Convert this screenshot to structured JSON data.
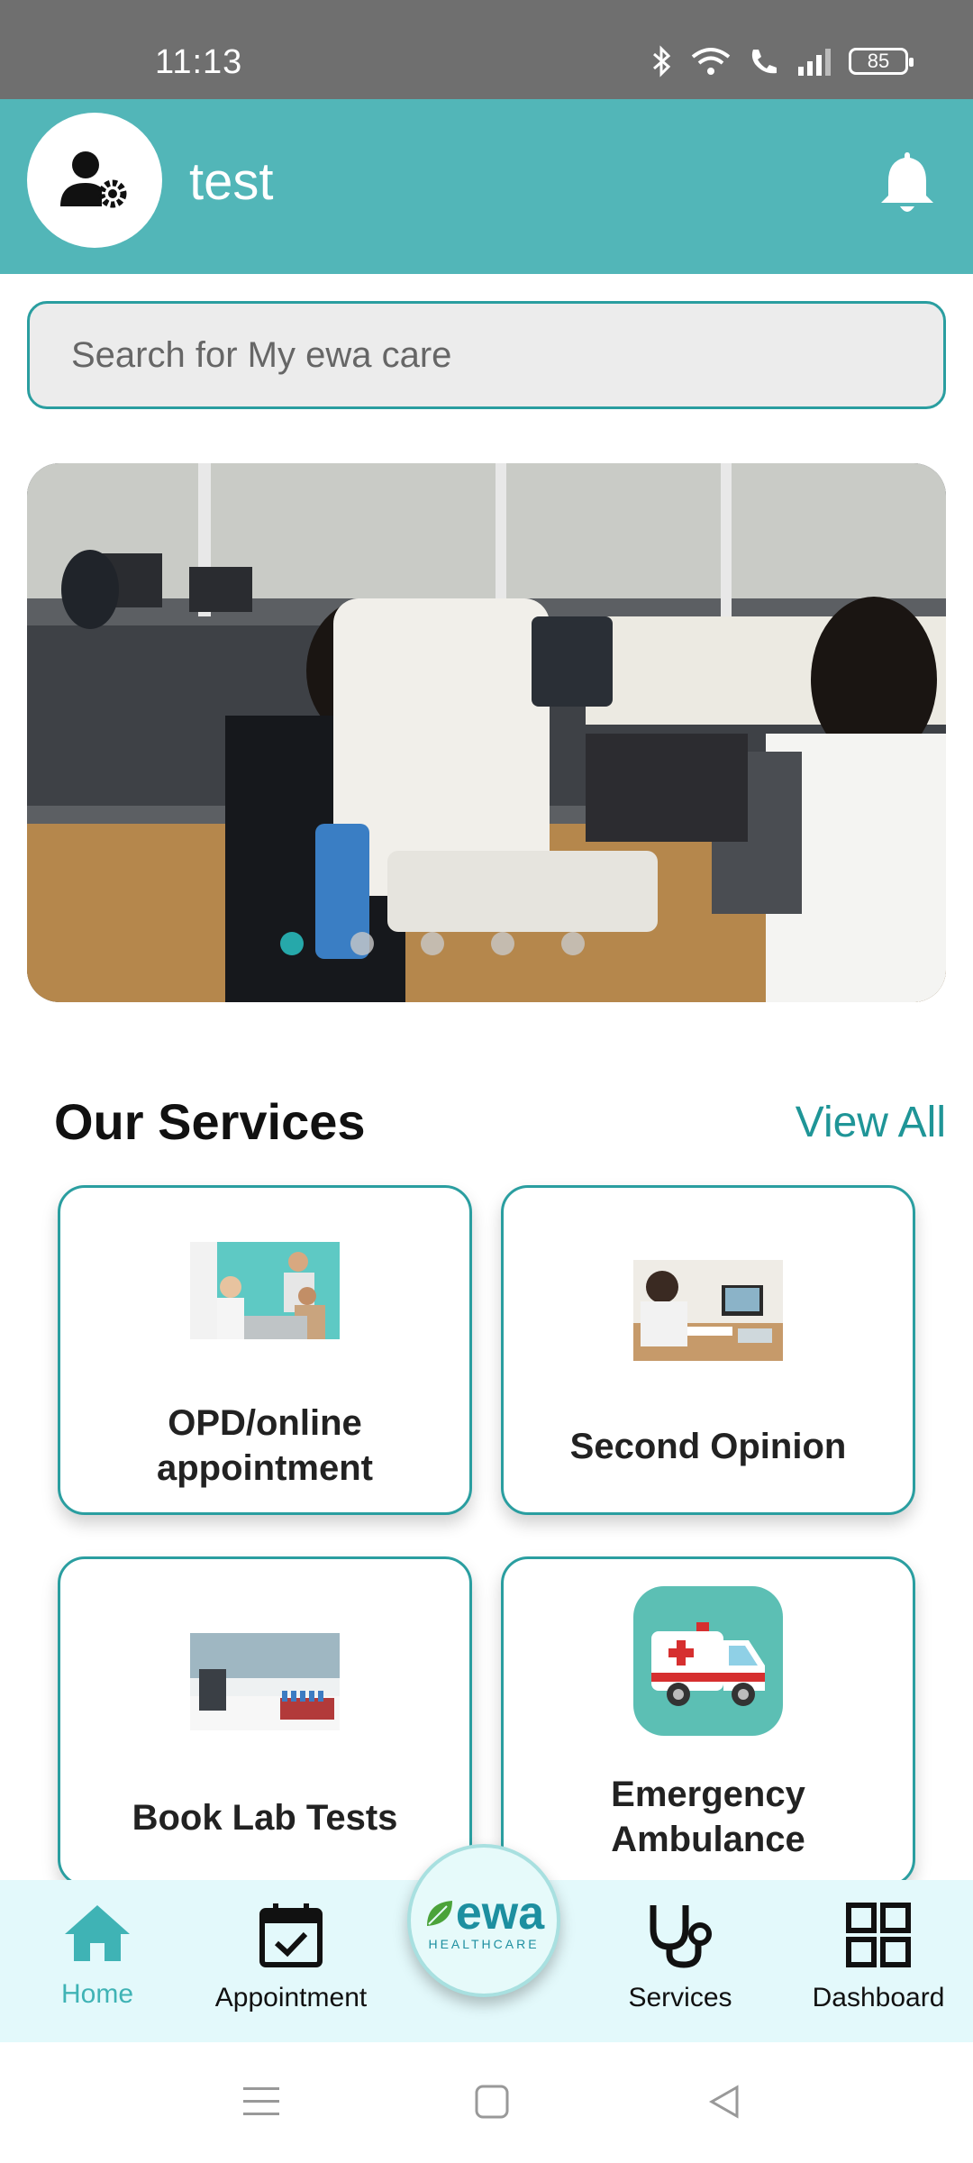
{
  "status_bar": {
    "time": "11:13",
    "battery": "85"
  },
  "header": {
    "username": "test"
  },
  "search": {
    "placeholder": "Search for My ewa care"
  },
  "banner": {
    "slide_count": 5,
    "active_index": 0
  },
  "services": {
    "title": "Our Services",
    "view_all": "View All",
    "cards": [
      {
        "label_line1": "OPD/online",
        "label_line2": "appointment"
      },
      {
        "label_line1": "Second Opinion"
      },
      {
        "label_line1": "Book Lab Tests"
      },
      {
        "label_line1": "Emergency",
        "label_line2": "Ambulance"
      }
    ]
  },
  "bottom_nav": {
    "home": "Home",
    "appointment": "Appointment",
    "services": "Services",
    "dashboard": "Dashboard",
    "logo_main": "ewa",
    "logo_sub": "HEALTHCARE"
  },
  "colors": {
    "primary": "#52b6b8",
    "accent": "#2a9ea0",
    "nav_bg": "#e3f9fb"
  }
}
